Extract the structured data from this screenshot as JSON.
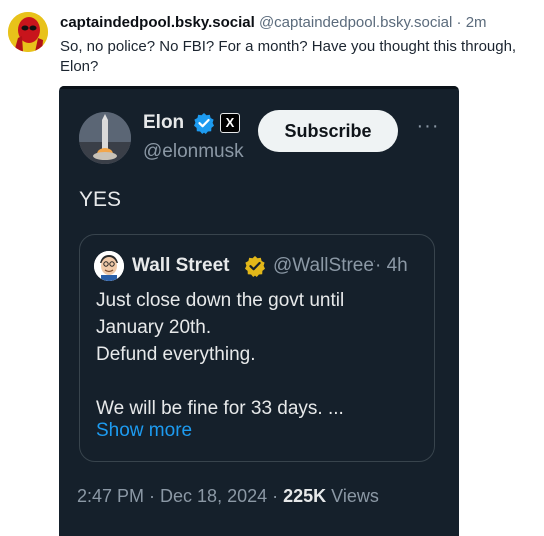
{
  "post": {
    "display_name": "captaindedpool.bsky.social",
    "handle": "@captaindedpool.bsky.social",
    "separator": "·",
    "time": "2m",
    "text": "So, no police? No FBI? For a month? Have you thought this through, Elon?"
  },
  "tweet": {
    "author_name": "Elon",
    "author_handle": "@elonmusk",
    "subscribe_label": "Subscribe",
    "more_label": "···",
    "badge_label": "X",
    "body": "YES",
    "quoted": {
      "author_name": "Wall Street",
      "author_handle": "@WallStreetSilver",
      "separator": "·",
      "time": "4h",
      "lines": [
        "Just close down the govt until",
        "January 20th.",
        "Defund everything.",
        "",
        "We will be fine for 33 days. ..."
      ],
      "show_more_label": "Show more"
    },
    "timestamp": "2:47 PM · Dec 18, 2024 · ",
    "views_count": "225K",
    "views_label": "Views"
  },
  "colors": {
    "verified_blue": "#1d9bf0",
    "verified_gold": "#e2b719",
    "card_bg": "#15202b",
    "link": "#1d9bf0"
  },
  "icons": {
    "bsky_avatar": "deadpool-avatar",
    "x_avatar": "rocket-launch-avatar",
    "quote_avatar": "cartoon-man-avatar",
    "verified": "verified-checkmark-icon",
    "x_logo": "x-logo-icon",
    "more": "more-icon"
  }
}
